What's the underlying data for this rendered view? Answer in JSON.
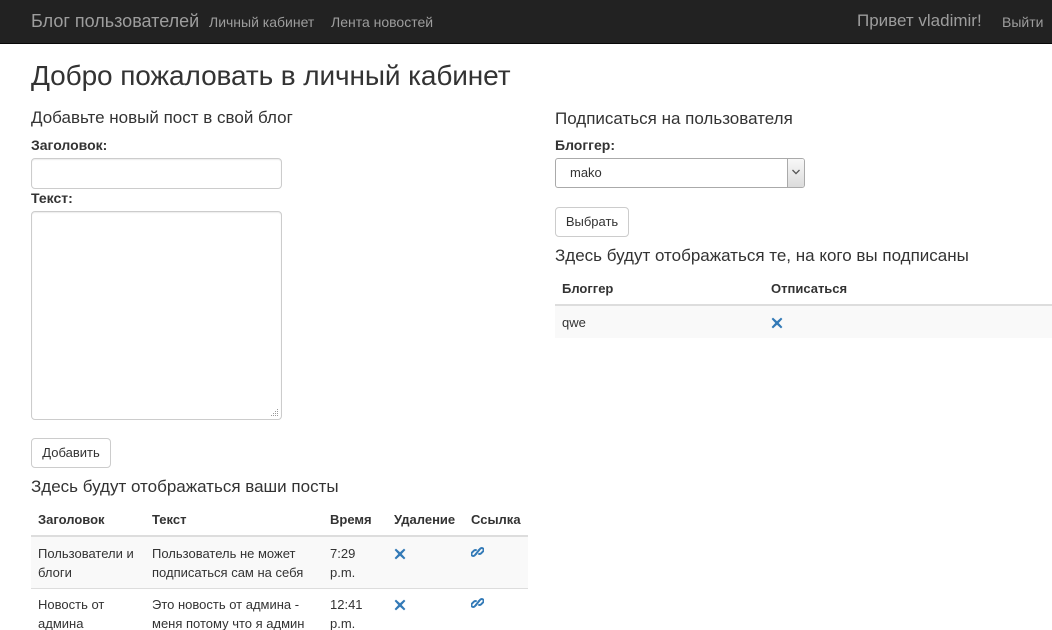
{
  "navbar": {
    "brand": "Блог пользователей",
    "links": [
      "Личный кабинет",
      "Лента новостей"
    ],
    "greeting": "Привет vladimir!",
    "logout": "Выйти"
  },
  "page": {
    "title": "Добро пожаловать в личный кабинет"
  },
  "new_post": {
    "heading": "Добавьте новый пост в свой блог",
    "title_label": "Заголовок:",
    "title_value": "",
    "text_label": "Текст:",
    "text_value": "",
    "submit": "Добавить"
  },
  "subscribe": {
    "heading": "Подписаться на пользователя",
    "blogger_label": "Блоггер:",
    "selected": "mako",
    "submit": "Выбрать"
  },
  "subscriptions": {
    "heading": "Здесь будут отображаться те, на кого вы подписаны",
    "columns": [
      "Блоггер",
      "Отписаться"
    ],
    "rows": [
      {
        "blogger": "qwe",
        "action_icon": "remove-icon"
      }
    ]
  },
  "posts": {
    "heading": "Здесь будут отображаться ваши посты",
    "columns": [
      "Заголовок",
      "Текст",
      "Время",
      "Удаление",
      "Ссылка"
    ],
    "rows": [
      {
        "title_lines": [
          "Пользователи и",
          "блоги"
        ],
        "text_lines": [
          "Пользователь не может",
          "подписаться сам на себя"
        ],
        "time_lines": [
          "7:29",
          "p.m."
        ],
        "delete_icon": "remove-icon",
        "link_icon": "link-icon"
      },
      {
        "title_lines": [
          "Новость от",
          "админа"
        ],
        "text_lines": [
          "Это новость от админа -",
          "меня потому что я админ"
        ],
        "time_lines": [
          "12:41",
          "p.m."
        ],
        "delete_icon": "remove-icon",
        "link_icon": "link-icon"
      }
    ]
  },
  "colors": {
    "navbar_bg": "#222222",
    "navbar_text": "#9d9d9d",
    "icon_blue": "#337ab7",
    "stripe": "#f9f9f9",
    "border": "#dddddd"
  }
}
